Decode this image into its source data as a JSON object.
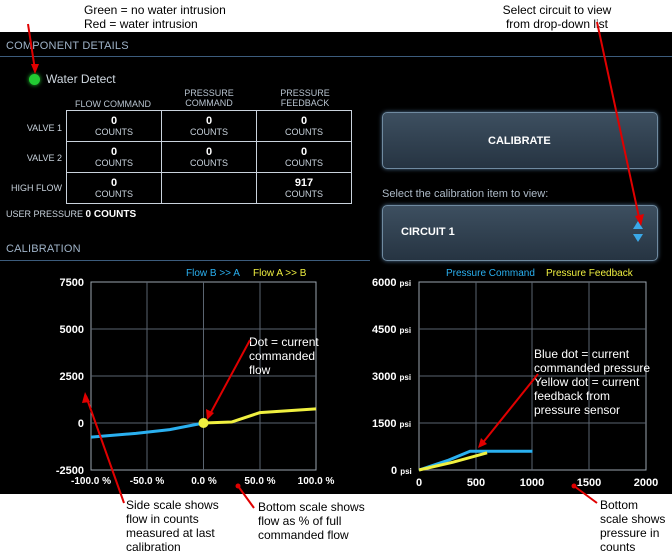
{
  "annotations": {
    "legend_green": "Green = no water intrusion",
    "legend_red": "Red = water intrusion",
    "select_circuit": "Select circuit to view\nfrom drop-down list",
    "dot_current": "Dot = current\ncommanded\nflow",
    "blue_yellow_dot": "Blue dot = current\ncommanded pressure\nYellow dot = current\nfeedback from\npressure sensor",
    "side_scale": "Side scale shows\nflow in counts\nmeasured at last\ncalibration",
    "bottom_scale_flow": "Bottom scale shows\nflow as % of full\ncommanded flow",
    "bottom_scale_pressure": "Bottom\nscale shows\npressure in\ncounts"
  },
  "component_details": {
    "title": "COMPONENT DETAILS",
    "water_detect": "Water Detect",
    "water_detect_color": "#22cc33",
    "headers": {
      "flow_command": "FLOW COMMAND",
      "pressure_command": "PRESSURE\nCOMMAND",
      "pressure_feedback": "PRESSURE\nFEEDBACK"
    },
    "rows": [
      {
        "label": "VALVE 1",
        "flow": "0",
        "flow_unit": "COUNTS",
        "pcmd": "0",
        "pcmd_unit": "COUNTS",
        "pfb": "0",
        "pfb_unit": "COUNTS"
      },
      {
        "label": "VALVE 2",
        "flow": "0",
        "flow_unit": "COUNTS",
        "pcmd": "0",
        "pcmd_unit": "COUNTS",
        "pfb": "0",
        "pfb_unit": "COUNTS"
      },
      {
        "label": "HIGH FLOW",
        "flow": "0",
        "flow_unit": "COUNTS",
        "pcmd": "",
        "pcmd_unit": "",
        "pfb": "917",
        "pfb_unit": "COUNTS"
      }
    ],
    "user_pressure_label": "USER PRESSURE",
    "user_pressure_value": "0 COUNTS"
  },
  "calibrate_button": "CALIBRATE",
  "calibration_select_caption": "Select the calibration item to view:",
  "calibration_select_value": "CIRCUIT 1",
  "calibration_title": "CALIBRATION",
  "colors": {
    "accent_blue": "#2ab0f0",
    "accent_yellow": "#f0f040",
    "annotation_red": "#e00000"
  },
  "chart_data": [
    {
      "type": "line",
      "legend_blue": "Flow B >> A",
      "legend_yellow": "Flow A >> B",
      "y_ticks": [
        "7500",
        "5000",
        "2500",
        "0",
        "-2500"
      ],
      "x_ticks": [
        "-100.0 %",
        "-50.0 %",
        "0.0 %",
        "50.0 %",
        "100.0 %"
      ],
      "ylim": [
        -2500,
        7500
      ],
      "xlim": [
        -100,
        100
      ],
      "series": [
        {
          "name": "Flow B >> A",
          "color": "#2ab0f0",
          "x": [
            -100,
            -60,
            -30,
            0
          ],
          "y": [
            -750,
            -550,
            -350,
            0
          ]
        },
        {
          "name": "Flow A >> B",
          "color": "#f0f040",
          "x": [
            0,
            25,
            50,
            75,
            100
          ],
          "y": [
            0,
            50,
            550,
            650,
            750
          ]
        }
      ],
      "current_point": {
        "x": 0,
        "y": 0,
        "color": "#f0f040"
      }
    },
    {
      "type": "line",
      "legend_blue": "Pressure Command",
      "legend_yellow": "Pressure Feedback",
      "y_ticks": [
        "6000",
        "4500",
        "3000",
        "1500",
        "0"
      ],
      "y_unit": "psi",
      "x_ticks": [
        "0",
        "500",
        "1000",
        "1500",
        "2000"
      ],
      "ylim": [
        0,
        6000
      ],
      "xlim": [
        0,
        2000
      ],
      "series": [
        {
          "name": "Pressure Command",
          "color": "#2ab0f0",
          "x": [
            0,
            250,
            450,
            1000
          ],
          "y": [
            0,
            300,
            600,
            600
          ]
        },
        {
          "name": "Pressure Feedback",
          "color": "#f0f040",
          "x": [
            0,
            300,
            600
          ],
          "y": [
            0,
            250,
            550
          ]
        }
      ]
    }
  ]
}
